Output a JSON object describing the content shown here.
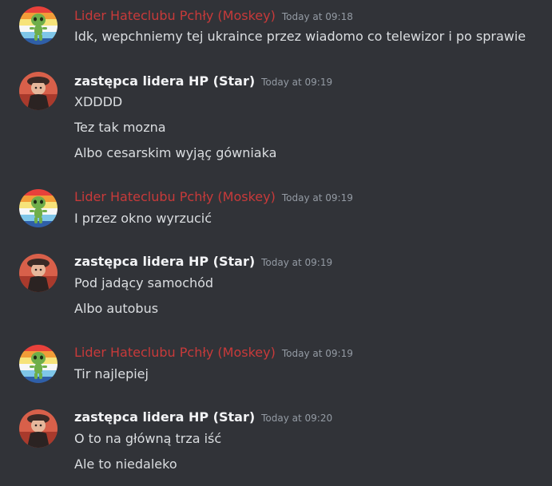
{
  "colors": {
    "background": "#313338",
    "moskey_name": "#c83a3a",
    "star_name": "#f2f3f5",
    "text": "#dbdee1",
    "timestamp": "#949ba4"
  },
  "messages": [
    {
      "author": "Lider Hateclubu Pchły (Moskey)",
      "timestamp": "Today at 09:18",
      "avatar_icon": "green-alien-plush-icon",
      "lines": [
        "Idk, wepchniemy tej ukraince przez wiadomo co telewizor i po sprawie"
      ]
    },
    {
      "author": "zastępca lidera HP (Star)",
      "timestamp": "Today at 09:19",
      "avatar_icon": "red-character-icon",
      "lines": [
        "XDDDD",
        "Tez tak mozna",
        "Albo cesarskim wyjąç gówniaka"
      ]
    },
    {
      "author": "Lider Hateclubu Pchły (Moskey)",
      "timestamp": "Today at 09:19",
      "avatar_icon": "green-alien-plush-icon",
      "lines": [
        "I przez okno wyrzucić"
      ]
    },
    {
      "author": "zastępca lidera HP (Star)",
      "timestamp": "Today at 09:19",
      "avatar_icon": "red-character-icon",
      "lines": [
        "Pod jadący samochód",
        "Albo autobus"
      ]
    },
    {
      "author": "Lider Hateclubu Pchły (Moskey)",
      "timestamp": "Today at 09:19",
      "avatar_icon": "green-alien-plush-icon",
      "lines": [
        "Tir najlepiej"
      ]
    },
    {
      "author": "zastępca lidera HP (Star)",
      "timestamp": "Today at 09:20",
      "avatar_icon": "red-character-icon",
      "lines": [
        "O to na główną trza iść",
        "Ale to niedaleko"
      ]
    }
  ]
}
